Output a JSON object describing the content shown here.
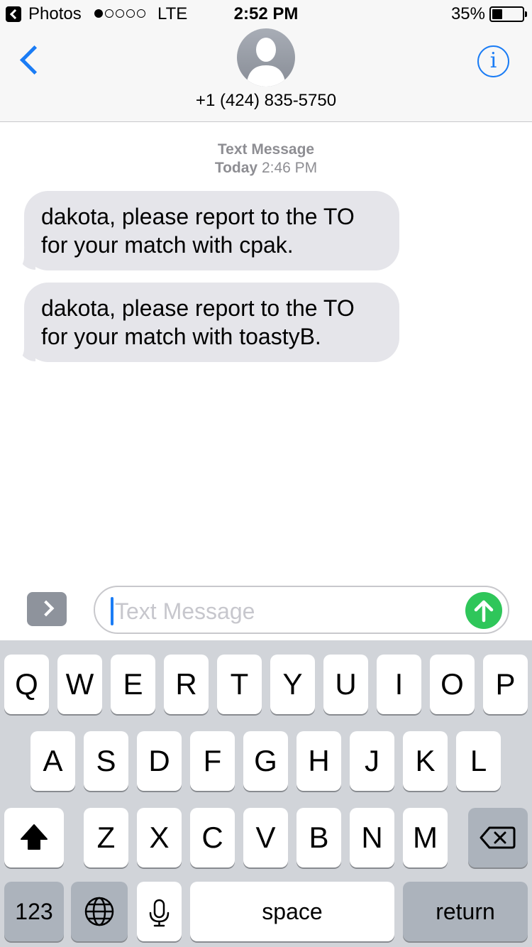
{
  "status_bar": {
    "back_app": "Photos",
    "carrier": "LTE",
    "time": "2:52 PM",
    "battery_percent": "35%",
    "battery_level": 0.35,
    "signal_bars": 1
  },
  "nav": {
    "contact": "+1 (424) 835-5750",
    "info_label": "i",
    "icons": {
      "back": "chevron-left-icon",
      "avatar": "person-icon",
      "info": "info-icon"
    }
  },
  "thread": {
    "service_label": "Text Message",
    "day": "Today",
    "time": "2:46 PM",
    "messages": [
      "dakota, please report to the TO for your match with cpak.",
      "dakota, please report to the TO for your match with toastyB."
    ]
  },
  "compose": {
    "placeholder": "Text Message",
    "accent_color": "#1a7cf5",
    "send_color": "#2fc65a"
  },
  "keyboard": {
    "row1": [
      "Q",
      "W",
      "E",
      "R",
      "T",
      "Y",
      "U",
      "I",
      "O",
      "P"
    ],
    "row2": [
      "A",
      "S",
      "D",
      "F",
      "G",
      "H",
      "J",
      "K",
      "L"
    ],
    "row3": [
      "Z",
      "X",
      "C",
      "V",
      "B",
      "N",
      "M"
    ],
    "numbers_key": "123",
    "space_key": "space",
    "return_key": "return"
  }
}
